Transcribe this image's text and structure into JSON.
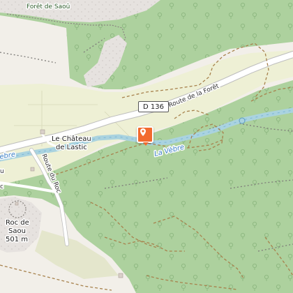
{
  "labels": {
    "forest": "Forêt de Saoû",
    "road_number": "D 136",
    "road_name": "Route de la Forêt",
    "chateau_line1": "Le Château",
    "chateau_line2": "de Lastic",
    "river_right": "La Vèbre",
    "river_left": "ebre",
    "road_roc": "Route du Roc",
    "roc_line1": "Roc de",
    "roc_line2": "Saou",
    "roc_elevation": "501 m",
    "left_edge_road": "u",
    "left_edge_roc": "c"
  },
  "marker": {
    "icon": "location-pin-icon",
    "color": "#f26a2e"
  },
  "colors": {
    "forest": "#add19e",
    "farmland": "#eef0d5",
    "rock": "#e4e0de",
    "water": "#aad3df",
    "river_line": "#7cb6d8",
    "road": "#ffffff",
    "trail": "#a7824d"
  }
}
